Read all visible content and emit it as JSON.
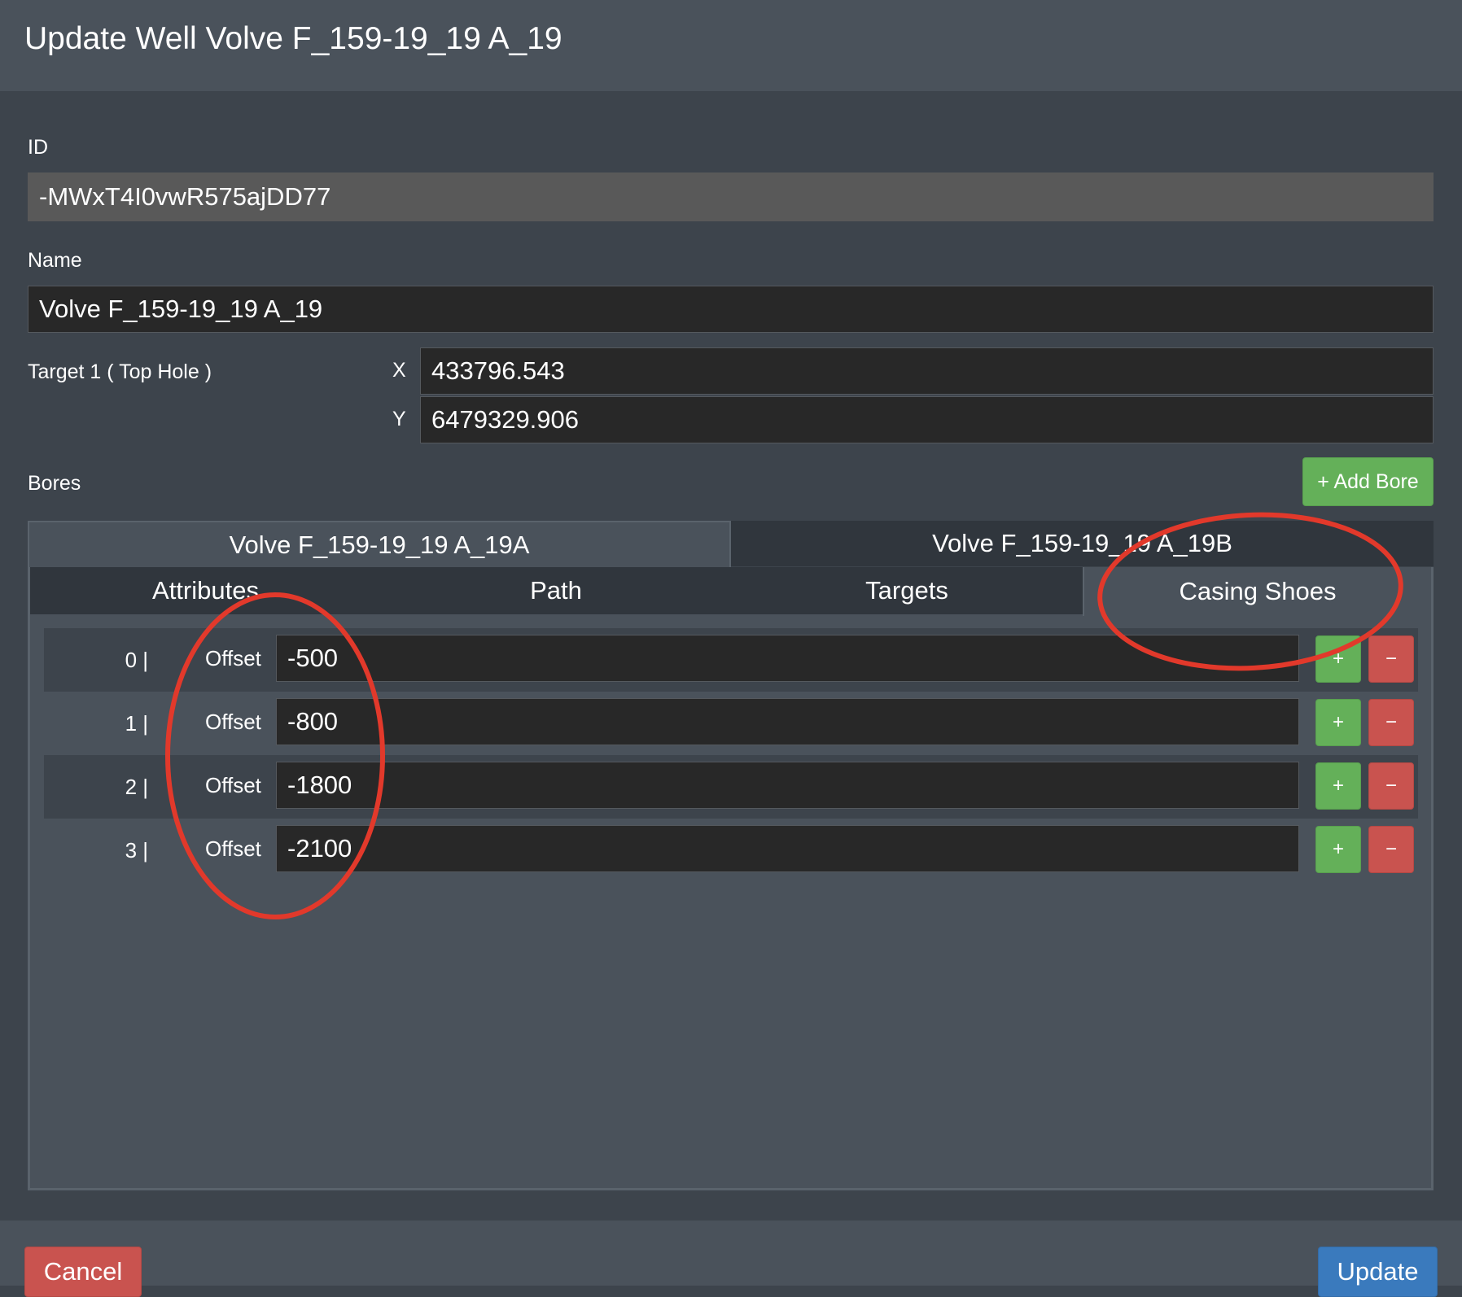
{
  "dialog": {
    "title": "Update Well Volve F_159-19_19 A_19"
  },
  "form": {
    "id_label": "ID",
    "id_value": "-MWxT4I0vwR575ajDD77",
    "name_label": "Name",
    "name_value": "Volve F_159-19_19 A_19",
    "target_label": "Target 1 ( Top Hole )",
    "x_label": "X",
    "x_value": "433796.543",
    "y_label": "Y",
    "y_value": "6479329.906"
  },
  "bores": {
    "label": "Bores",
    "add_button": "+ Add Bore",
    "tabs": [
      {
        "label": "Volve F_159-19_19 A_19A",
        "active": true
      },
      {
        "label": "Volve F_159-19_19 A_19B",
        "active": false
      }
    ],
    "sub_tabs": [
      {
        "label": "Attributes",
        "active": false
      },
      {
        "label": "Path",
        "active": false
      },
      {
        "label": "Targets",
        "active": false
      },
      {
        "label": "Casing Shoes",
        "active": true
      }
    ],
    "casing_shoes": [
      {
        "index": "0 |",
        "label": "Offset",
        "value": "-500"
      },
      {
        "index": "1 |",
        "label": "Offset",
        "value": "-800"
      },
      {
        "index": "2 |",
        "label": "Offset",
        "value": "-1800"
      },
      {
        "index": "3 |",
        "label": "Offset",
        "value": "-2100"
      }
    ],
    "add_row_label": "+",
    "remove_row_label": "−"
  },
  "footer": {
    "cancel_label": "Cancel",
    "update_label": "Update"
  },
  "colors": {
    "background": "#3d444c",
    "header": "#4a525b",
    "field": "#282828",
    "readonly_field": "#595959",
    "green": "#64b059",
    "red": "#c9534f",
    "blue": "#3a7abd",
    "annotation": "#e2392b"
  }
}
